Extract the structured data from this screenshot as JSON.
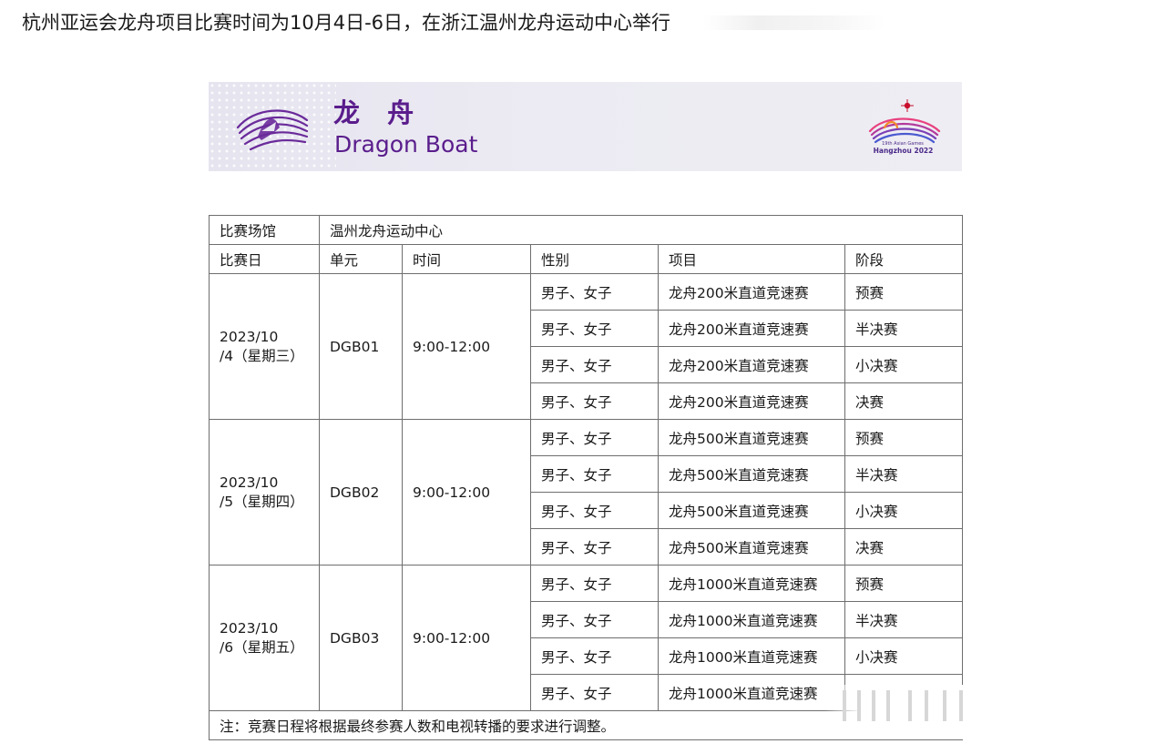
{
  "headline": "杭州亚运会龙舟项目比赛时间为10月4日-6日，在浙江温州龙舟运动中心举行",
  "banner": {
    "title_zh": "龙 舟",
    "title_en": "Dragon Boat",
    "emblem_caption": "19th Asian Games",
    "emblem_name": "Hangzhou 2022"
  },
  "table": {
    "venue_label": "比赛场馆",
    "venue_value": "温州龙舟运动中心",
    "headers": [
      "比赛日",
      "单元",
      "时间",
      "性别",
      "项目",
      "阶段"
    ],
    "sessions": [
      {
        "date_line1": "2023/10",
        "date_line2": "/4（星期三）",
        "unit": "DGB01",
        "time": "9:00-12:00",
        "events": [
          {
            "gender": "男子、女子",
            "event": "龙舟200米直道竞速赛",
            "stage": "预赛"
          },
          {
            "gender": "男子、女子",
            "event": "龙舟200米直道竞速赛",
            "stage": "半决赛"
          },
          {
            "gender": "男子、女子",
            "event": "龙舟200米直道竞速赛",
            "stage": "小决赛"
          },
          {
            "gender": "男子、女子",
            "event": "龙舟200米直道竞速赛",
            "stage": "决赛"
          }
        ]
      },
      {
        "date_line1": "2023/10",
        "date_line2": "/5（星期四）",
        "unit": "DGB02",
        "time": "9:00-12:00",
        "events": [
          {
            "gender": "男子、女子",
            "event": "龙舟500米直道竞速赛",
            "stage": "预赛"
          },
          {
            "gender": "男子、女子",
            "event": "龙舟500米直道竞速赛",
            "stage": "半决赛"
          },
          {
            "gender": "男子、女子",
            "event": "龙舟500米直道竞速赛",
            "stage": "小决赛"
          },
          {
            "gender": "男子、女子",
            "event": "龙舟500米直道竞速赛",
            "stage": "决赛"
          }
        ]
      },
      {
        "date_line1": "2023/10",
        "date_line2": "/6（星期五）",
        "unit": "DGB03",
        "time": "9:00-12:00",
        "events": [
          {
            "gender": "男子、女子",
            "event": "龙舟1000米直道竞速赛",
            "stage": "预赛"
          },
          {
            "gender": "男子、女子",
            "event": "龙舟1000米直道竞速赛",
            "stage": "半决赛"
          },
          {
            "gender": "男子、女子",
            "event": "龙舟1000米直道竞速赛",
            "stage": "小决赛"
          },
          {
            "gender": "男子、女子",
            "event": "龙舟1000米直道竞速赛",
            "stage": ""
          }
        ]
      }
    ],
    "note": "注：竞赛日程将根据最终参赛人数和电视转播的要求进行调整。"
  },
  "colors": {
    "accent_purple": "#5a1d8c",
    "border": "#6e6e6e",
    "banner_bg": "#e9e7f1"
  },
  "icons": [
    "dragon-boat-logo-icon",
    "asian-games-emblem-icon"
  ]
}
